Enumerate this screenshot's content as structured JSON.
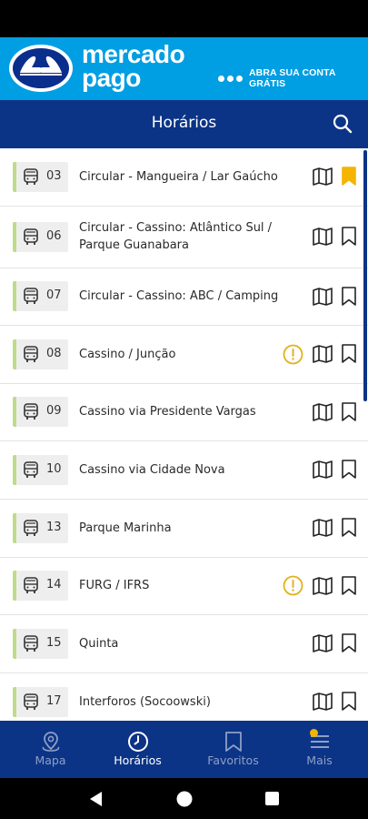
{
  "ad": {
    "brand_line1": "mercado",
    "brand_line2": "pago",
    "cta": "ABRA SUA CONTA GRÁTIS"
  },
  "header": {
    "title": "Horários",
    "search_icon": "search-icon"
  },
  "routes": [
    {
      "number": "03",
      "name": "Circular - Mangueira / Lar Gaúcho",
      "alert": false,
      "favorite": true
    },
    {
      "number": "06",
      "name": "Circular - Cassino: Atlântico Sul / Parque Guanabara",
      "alert": false,
      "favorite": false
    },
    {
      "number": "07",
      "name": "Circular -  Cassino: ABC / Camping",
      "alert": false,
      "favorite": false
    },
    {
      "number": "08",
      "name": "Cassino / Junção",
      "alert": true,
      "favorite": false
    },
    {
      "number": "09",
      "name": "Cassino via Presidente Vargas",
      "alert": false,
      "favorite": false
    },
    {
      "number": "10",
      "name": "Cassino via Cidade Nova",
      "alert": false,
      "favorite": false
    },
    {
      "number": "13",
      "name": "Parque Marinha",
      "alert": false,
      "favorite": false
    },
    {
      "number": "14",
      "name": "FURG / IFRS",
      "alert": true,
      "favorite": false
    },
    {
      "number": "15",
      "name": "Quinta",
      "alert": false,
      "favorite": false
    },
    {
      "number": "17",
      "name": "Interforos (Socoowski)",
      "alert": false,
      "favorite": false
    }
  ],
  "bottom_nav": [
    {
      "label": "Mapa",
      "icon": "map-pin-icon",
      "active": false
    },
    {
      "label": "Horários",
      "icon": "clock-icon",
      "active": true
    },
    {
      "label": "Favoritos",
      "icon": "bookmark-icon",
      "active": false
    },
    {
      "label": "Mais",
      "icon": "menu-icon",
      "active": false
    }
  ],
  "colors": {
    "header": "#0b3486",
    "ad_background": "#009ee3",
    "chip_accent": "#bedb8a",
    "alert": "#e0b21c",
    "favorite": "#f4b400"
  }
}
